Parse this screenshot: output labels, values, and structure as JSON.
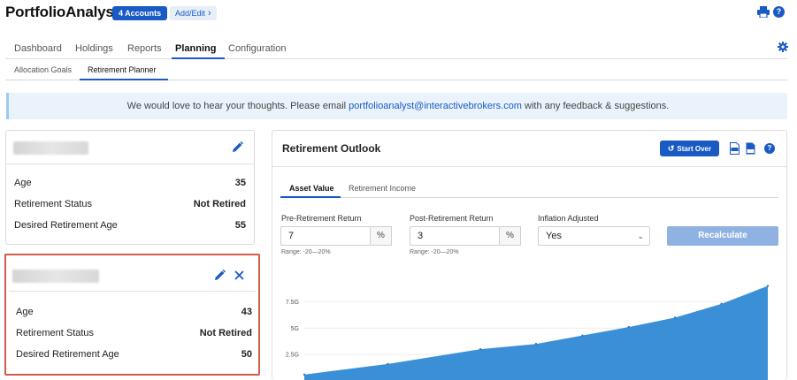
{
  "header": {
    "brand": "PortfolioAnalyst",
    "accounts_label": "4 Accounts",
    "add_edit_label": "Add/Edit",
    "help_glyph": "?"
  },
  "icons": {
    "print": "print-icon",
    "help": "help-icon",
    "settings": "gear-icon",
    "edit": "pencil-icon",
    "remove": "close-icon",
    "pdf": "pdf-icon",
    "csv": "csv-icon"
  },
  "nav": {
    "tabs": [
      {
        "label": "Dashboard"
      },
      {
        "label": "Holdings"
      },
      {
        "label": "Reports"
      },
      {
        "label": "Planning"
      },
      {
        "label": "Configuration"
      }
    ],
    "active_tab": "Planning",
    "subtabs": [
      {
        "label": "Allocation Goals"
      },
      {
        "label": "Retirement Planner"
      }
    ],
    "active_subtab": "Retirement Planner"
  },
  "banner": {
    "text_before": "We would love to hear your thoughts. Please email ",
    "email": "portfolioanalyst@interactivebrokers.com",
    "text_after": " with any feedback & suggestions."
  },
  "profiles": [
    {
      "rows": [
        {
          "label": "Age",
          "value": "35"
        },
        {
          "label": "Retirement Status",
          "value": "Not Retired"
        },
        {
          "label": "Desired Retirement Age",
          "value": "55"
        }
      ]
    },
    {
      "rows": [
        {
          "label": "Age",
          "value": "43"
        },
        {
          "label": "Retirement Status",
          "value": "Not Retired"
        },
        {
          "label": "Desired Retirement Age",
          "value": "50"
        }
      ]
    }
  ],
  "outlook": {
    "title": "Retirement Outlook",
    "start_over_label": "Start Over",
    "tabs": [
      {
        "label": "Asset Value"
      },
      {
        "label": "Retirement Income"
      }
    ],
    "active_tab": "Asset Value",
    "fields": {
      "pre_return": {
        "label": "Pre-Retirement Return",
        "value": "7",
        "suffix": "%",
        "range": "Range: -20—20%"
      },
      "post_return": {
        "label": "Post-Retirement Return",
        "value": "3",
        "suffix": "%",
        "range": "Range: -20—20%"
      },
      "inflation": {
        "label": "Inflation Adjusted",
        "value": "Yes"
      }
    },
    "recalculate_label": "Recalculate"
  },
  "colors": {
    "accent": "#1a5ac4",
    "chart_fill": "#3b8fd6",
    "highlight_border": "#d45a4a"
  },
  "chart_data": {
    "type": "area",
    "yticks": [
      {
        "label": "2.5G",
        "value": 2.5
      },
      {
        "label": "5G",
        "value": 5
      },
      {
        "label": "7.5G",
        "value": 7.5
      }
    ],
    "ylim": [
      0,
      10.3
    ],
    "x": [
      0,
      0.18,
      0.38,
      0.5,
      0.6,
      0.7,
      0.8,
      0.9,
      1.0
    ],
    "values": [
      0.6,
      1.6,
      3.0,
      3.5,
      4.3,
      5.1,
      6.0,
      7.3,
      9.0
    ]
  }
}
